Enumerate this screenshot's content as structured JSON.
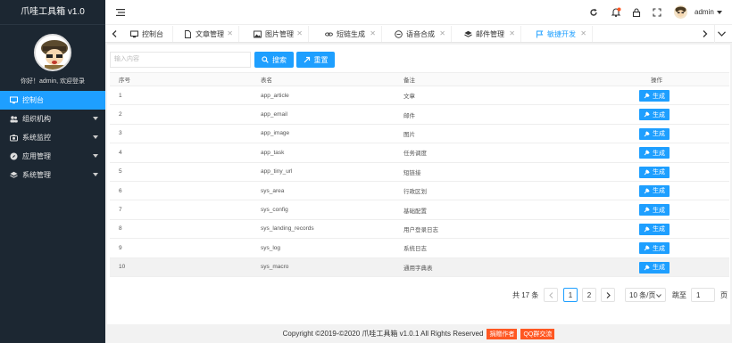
{
  "app": {
    "title": "爪哇工具箱 v1.0"
  },
  "sidebar": {
    "welcome": "你好！admin, 欢迎登录",
    "items": [
      {
        "label": "控制台",
        "icon": "monitor-icon"
      },
      {
        "label": "组织机构",
        "icon": "users-icon"
      },
      {
        "label": "系统监控",
        "icon": "camera-icon"
      },
      {
        "label": "应用管理",
        "icon": "compass-icon"
      },
      {
        "label": "系统管理",
        "icon": "layers-icon"
      }
    ]
  },
  "header": {
    "username": "admin"
  },
  "tabs": [
    {
      "label": "控制台"
    },
    {
      "label": "文章管理"
    },
    {
      "label": "图片管理"
    },
    {
      "label": "短链生成"
    },
    {
      "label": "语音合成"
    },
    {
      "label": "邮件管理"
    },
    {
      "label": "敏捷开发"
    }
  ],
  "toolbar": {
    "search_placeholder": "输入内容",
    "search_label": "搜索",
    "reset_label": "重置"
  },
  "table": {
    "columns": [
      "序号",
      "表名",
      "备注",
      "操作"
    ],
    "action_label": "生成",
    "rows": [
      {
        "no": "1",
        "name": "app_article",
        "remark": "文章"
      },
      {
        "no": "2",
        "name": "app_email",
        "remark": "邮件"
      },
      {
        "no": "3",
        "name": "app_image",
        "remark": "图片"
      },
      {
        "no": "4",
        "name": "app_task",
        "remark": "任务调度"
      },
      {
        "no": "5",
        "name": "app_tiny_url",
        "remark": "短链接"
      },
      {
        "no": "6",
        "name": "sys_area",
        "remark": "行政区划"
      },
      {
        "no": "7",
        "name": "sys_config",
        "remark": "基础配置"
      },
      {
        "no": "8",
        "name": "sys_landing_records",
        "remark": "用户登录日志"
      },
      {
        "no": "9",
        "name": "sys_log",
        "remark": "系统日志"
      },
      {
        "no": "10",
        "name": "sys_macro",
        "remark": "通用字典表"
      }
    ]
  },
  "pagination": {
    "total": "共 17 条",
    "pages": [
      "1",
      "2"
    ],
    "current": "1",
    "page_size": "10 条/页",
    "goto_label": "跳至",
    "goto_value": "1",
    "page_unit": "页"
  },
  "footer": {
    "copyright": "Copyright ©2019-©2020 爪哇工具箱 v1.0.1 All Rights Reserved",
    "badge1": "捐赠作者",
    "badge2": "QQ群交流"
  },
  "colors": {
    "primary": "#1e9fff",
    "sidebar": "#1c2732",
    "badge": "#ff5722"
  }
}
